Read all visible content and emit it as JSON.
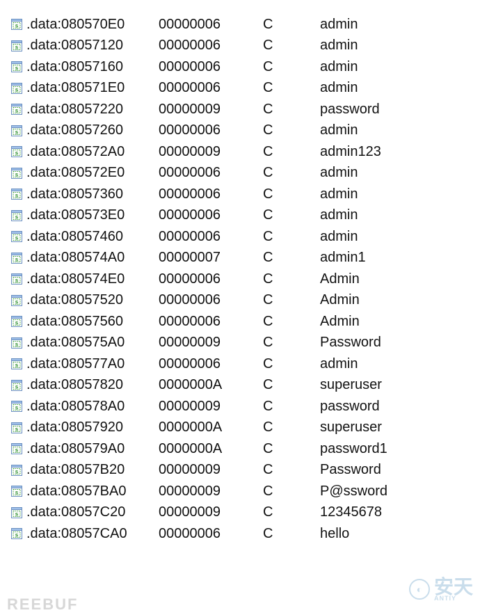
{
  "strings": [
    {
      "address": ".data:080570E0",
      "length": "00000006",
      "type": "C",
      "value": "admin"
    },
    {
      "address": ".data:08057120",
      "length": "00000006",
      "type": "C",
      "value": "admin"
    },
    {
      "address": ".data:08057160",
      "length": "00000006",
      "type": "C",
      "value": "admin"
    },
    {
      "address": ".data:080571E0",
      "length": "00000006",
      "type": "C",
      "value": "admin"
    },
    {
      "address": ".data:08057220",
      "length": "00000009",
      "type": "C",
      "value": "password"
    },
    {
      "address": ".data:08057260",
      "length": "00000006",
      "type": "C",
      "value": "admin"
    },
    {
      "address": ".data:080572A0",
      "length": "00000009",
      "type": "C",
      "value": "admin123"
    },
    {
      "address": ".data:080572E0",
      "length": "00000006",
      "type": "C",
      "value": "admin"
    },
    {
      "address": ".data:08057360",
      "length": "00000006",
      "type": "C",
      "value": "admin"
    },
    {
      "address": ".data:080573E0",
      "length": "00000006",
      "type": "C",
      "value": "admin"
    },
    {
      "address": ".data:08057460",
      "length": "00000006",
      "type": "C",
      "value": "admin"
    },
    {
      "address": ".data:080574A0",
      "length": "00000007",
      "type": "C",
      "value": "admin1"
    },
    {
      "address": ".data:080574E0",
      "length": "00000006",
      "type": "C",
      "value": "Admin"
    },
    {
      "address": ".data:08057520",
      "length": "00000006",
      "type": "C",
      "value": "Admin"
    },
    {
      "address": ".data:08057560",
      "length": "00000006",
      "type": "C",
      "value": "Admin"
    },
    {
      "address": ".data:080575A0",
      "length": "00000009",
      "type": "C",
      "value": "Password"
    },
    {
      "address": ".data:080577A0",
      "length": "00000006",
      "type": "C",
      "value": "admin"
    },
    {
      "address": ".data:08057820",
      "length": "0000000A",
      "type": "C",
      "value": "superuser"
    },
    {
      "address": ".data:080578A0",
      "length": "00000009",
      "type": "C",
      "value": "password"
    },
    {
      "address": ".data:08057920",
      "length": "0000000A",
      "type": "C",
      "value": "superuser"
    },
    {
      "address": ".data:080579A0",
      "length": "0000000A",
      "type": "C",
      "value": "password1"
    },
    {
      "address": ".data:08057B20",
      "length": "00000009",
      "type": "C",
      "value": "Password"
    },
    {
      "address": ".data:08057BA0",
      "length": "00000009",
      "type": "C",
      "value": "P@ssword"
    },
    {
      "address": ".data:08057C20",
      "length": "00000009",
      "type": "C",
      "value": "12345678"
    },
    {
      "address": ".data:08057CA0",
      "length": "00000006",
      "type": "C",
      "value": "hello"
    }
  ],
  "watermark_bottom_left": "REEBUF",
  "watermark_bottom_right": {
    "main": "安天",
    "sub": "ANTIY"
  }
}
